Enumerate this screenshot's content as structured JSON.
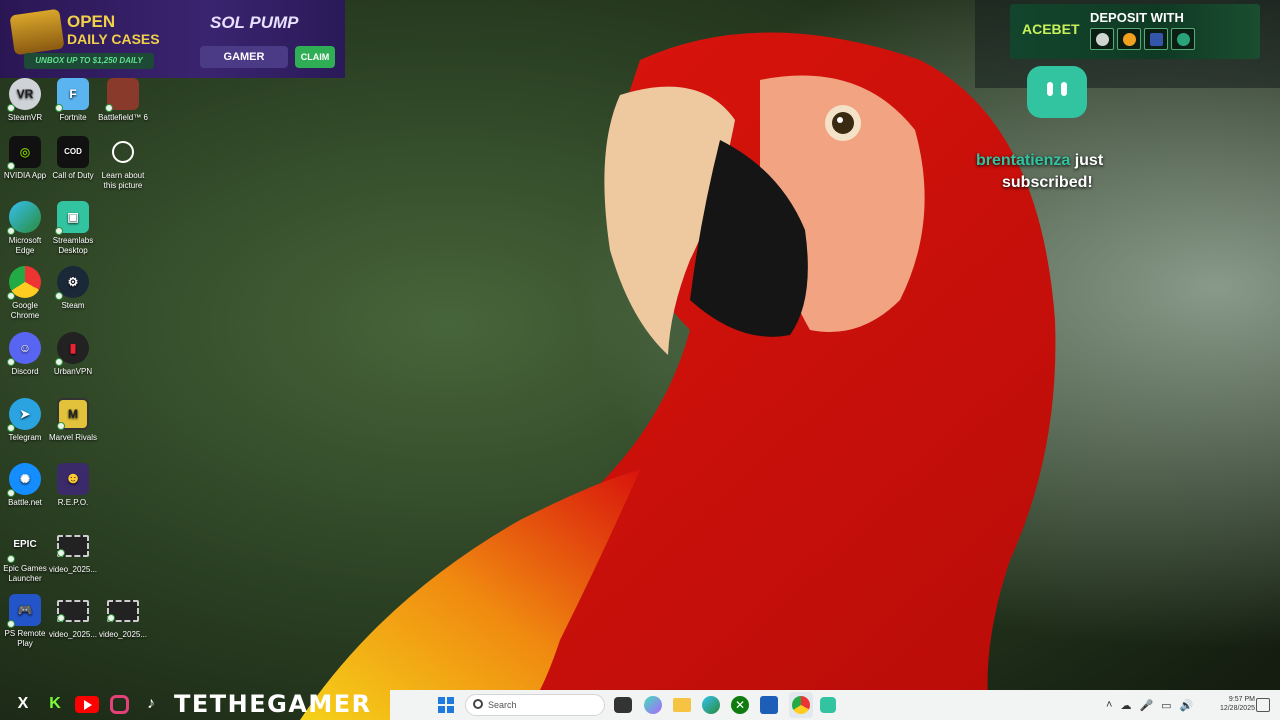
{
  "wallpaper": {
    "subject": "scarlet macaw"
  },
  "banner_left": {
    "open": "OPEN",
    "daily": "DAILY CASES",
    "unbox": "UNBOX UP TO $1,250 DAILY",
    "sol_pump": "SOL PUMP",
    "gamer": "GAMER",
    "claim": "CLAIM"
  },
  "banner_right": {
    "brand": "ACEBET",
    "deposit": "DEPOSIT WITH"
  },
  "alert": {
    "name": "brentatienza",
    "just": "just",
    "subscribed": "subscribed!"
  },
  "desktop_icons": [
    {
      "label": "SteamVR"
    },
    {
      "label": "Fortnite"
    },
    {
      "label": "Battlefield™ 6"
    },
    {
      "label": "NVIDIA App"
    },
    {
      "label": "Call of Duty"
    },
    {
      "label": "Learn about this picture"
    },
    {
      "label": "Microsoft Edge"
    },
    {
      "label": "Streamlabs Desktop"
    },
    {
      "label": "Google Chrome"
    },
    {
      "label": "Steam"
    },
    {
      "label": "Discord"
    },
    {
      "label": "UrbanVPN"
    },
    {
      "label": "Telegram"
    },
    {
      "label": "Marvel Rivals"
    },
    {
      "label": "Battle.net"
    },
    {
      "label": "R.E.P.O."
    },
    {
      "label": "Epic Games Launcher"
    },
    {
      "label": "video_2025..."
    },
    {
      "label": "PS Remote Play"
    },
    {
      "label": "video_2025..."
    },
    {
      "label": "video_2025..."
    }
  ],
  "social": {
    "handle": "TETHEGAMER"
  },
  "taskbar": {
    "search_placeholder": "Search",
    "time": "9:57 PM",
    "date": "12/28/2025"
  },
  "colors": {
    "accent": "#32c3a1",
    "taskbar": "#f2f3f3"
  }
}
